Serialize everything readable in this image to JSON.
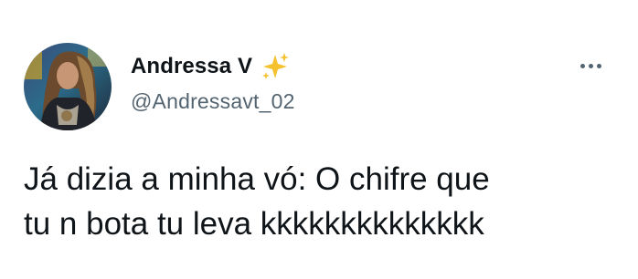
{
  "tweet": {
    "author": {
      "display_name": "Andressa V",
      "handle": "@Andressavt_02",
      "name_emoji_icon": "sparkles-icon",
      "avatar_icon": "user-avatar"
    },
    "menu_icon": "more-options-icon",
    "text": "Já dizia a minha vó: O chifre que\ntu n bota tu leva kkkkkkkkkkkkkk"
  },
  "colors": {
    "text_primary": "#0f1419",
    "text_secondary": "#536471",
    "sparkle": "#f4c430"
  }
}
